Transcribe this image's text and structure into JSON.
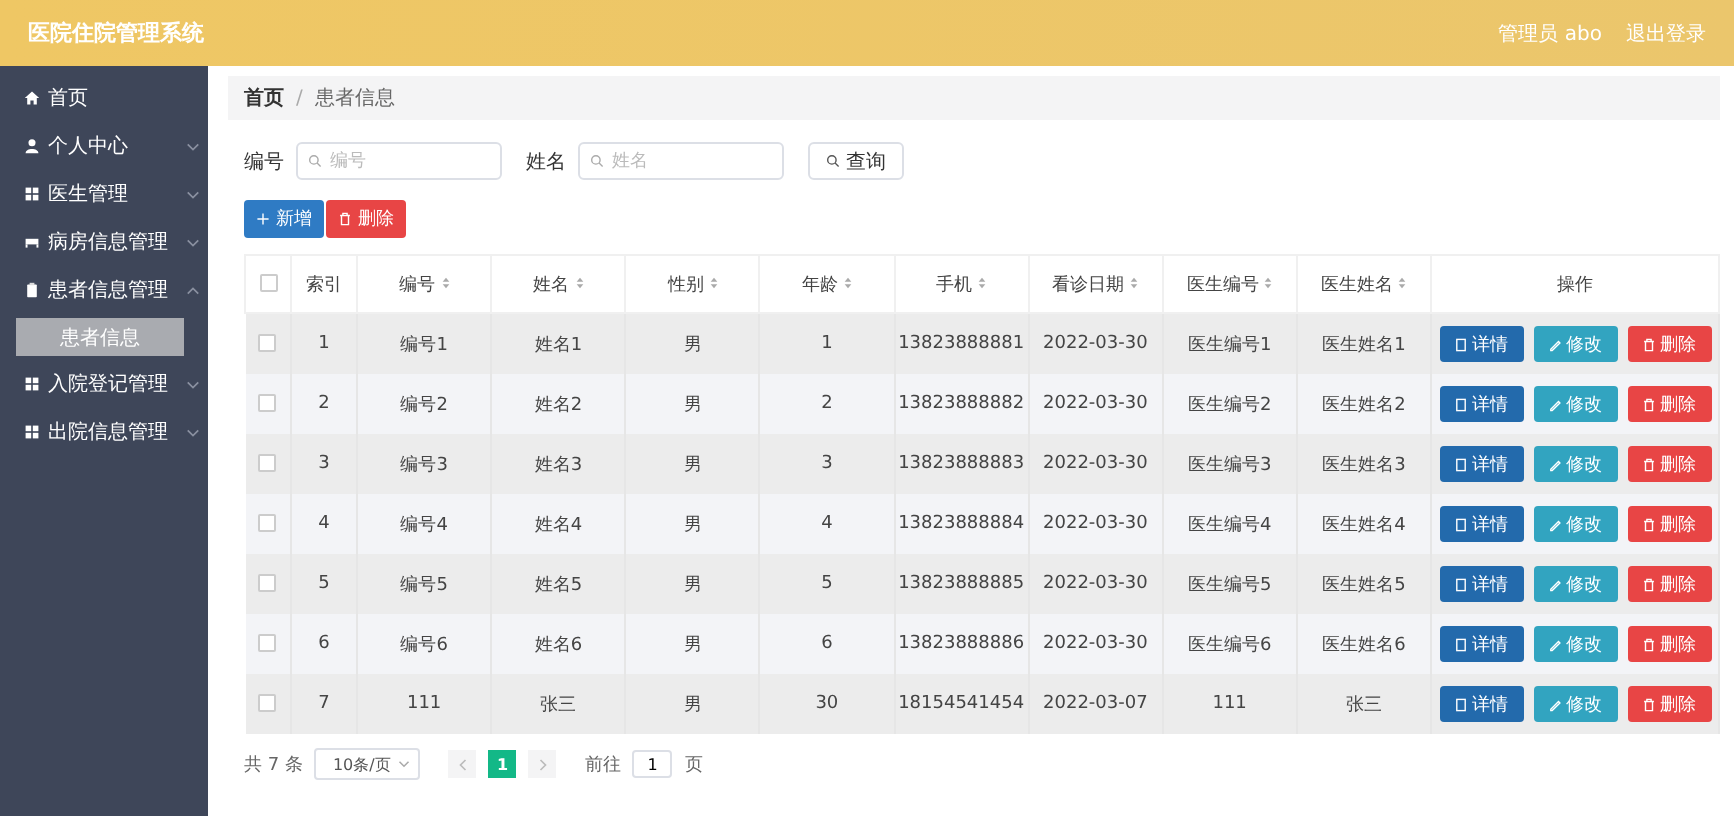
{
  "header": {
    "title": "医院住院管理系统",
    "user": "管理员 abo",
    "logout": "退出登录"
  },
  "sidebar": {
    "items": [
      {
        "label": "首页",
        "kind": "link"
      },
      {
        "label": "个人中心",
        "kind": "submenu",
        "expanded": false
      },
      {
        "label": "医生管理",
        "kind": "submenu",
        "expanded": false
      },
      {
        "label": "病房信息管理",
        "kind": "submenu",
        "expanded": false
      },
      {
        "label": "患者信息管理",
        "kind": "submenu",
        "expanded": true,
        "children": [
          {
            "label": "患者信息",
            "selected": true
          }
        ]
      },
      {
        "label": "入院登记管理",
        "kind": "submenu",
        "expanded": false
      },
      {
        "label": "出院信息管理",
        "kind": "submenu",
        "expanded": false
      }
    ]
  },
  "breadcrumb": {
    "separator": "/",
    "items": [
      "首页",
      "患者信息"
    ]
  },
  "search": {
    "fields": [
      {
        "label": "编号",
        "placeholder": "编号"
      },
      {
        "label": "姓名",
        "placeholder": "姓名"
      }
    ],
    "button": "查询"
  },
  "actions": [
    {
      "label": "新增",
      "kind": "add"
    },
    {
      "label": "删除",
      "kind": "delete"
    }
  ],
  "table": {
    "all_checked": false,
    "columns": [
      {
        "label": "索引",
        "sortable": false
      },
      {
        "label": "编号",
        "sortable": true
      },
      {
        "label": "姓名",
        "sortable": true
      },
      {
        "label": "性别",
        "sortable": true
      },
      {
        "label": "年龄",
        "sortable": true
      },
      {
        "label": "手机",
        "sortable": true
      },
      {
        "label": "看诊日期",
        "sortable": true
      },
      {
        "label": "医生编号",
        "sortable": true
      },
      {
        "label": "医生姓名",
        "sortable": true
      },
      {
        "label": "操作",
        "sortable": false
      }
    ],
    "rows": [
      {
        "checked": false,
        "cells": [
          "1",
          "编号1",
          "姓名1",
          "男",
          "1",
          "13823888881",
          "2022-03-30",
          "医生编号1",
          "医生姓名1"
        ],
        "buttons": [
          {
            "label": "详情",
            "kind": "detail"
          },
          {
            "label": "修改",
            "kind": "edit"
          },
          {
            "label": "删除",
            "kind": "delete"
          }
        ]
      },
      {
        "checked": false,
        "cells": [
          "2",
          "编号2",
          "姓名2",
          "男",
          "2",
          "13823888882",
          "2022-03-30",
          "医生编号2",
          "医生姓名2"
        ],
        "buttons": [
          {
            "label": "详情",
            "kind": "detail"
          },
          {
            "label": "修改",
            "kind": "edit"
          },
          {
            "label": "删除",
            "kind": "delete"
          }
        ]
      },
      {
        "checked": false,
        "cells": [
          "3",
          "编号3",
          "姓名3",
          "男",
          "3",
          "13823888883",
          "2022-03-30",
          "医生编号3",
          "医生姓名3"
        ],
        "buttons": [
          {
            "label": "详情",
            "kind": "detail"
          },
          {
            "label": "修改",
            "kind": "edit"
          },
          {
            "label": "删除",
            "kind": "delete"
          }
        ]
      },
      {
        "checked": false,
        "cells": [
          "4",
          "编号4",
          "姓名4",
          "男",
          "4",
          "13823888884",
          "2022-03-30",
          "医生编号4",
          "医生姓名4"
        ],
        "buttons": [
          {
            "label": "详情",
            "kind": "detail"
          },
          {
            "label": "修改",
            "kind": "edit"
          },
          {
            "label": "删除",
            "kind": "delete"
          }
        ]
      },
      {
        "checked": false,
        "cells": [
          "5",
          "编号5",
          "姓名5",
          "男",
          "5",
          "13823888885",
          "2022-03-30",
          "医生编号5",
          "医生姓名5"
        ],
        "buttons": [
          {
            "label": "详情",
            "kind": "detail"
          },
          {
            "label": "修改",
            "kind": "edit"
          },
          {
            "label": "删除",
            "kind": "delete"
          }
        ]
      },
      {
        "checked": false,
        "cells": [
          "6",
          "编号6",
          "姓名6",
          "男",
          "6",
          "13823888886",
          "2022-03-30",
          "医生编号6",
          "医生姓名6"
        ],
        "buttons": [
          {
            "label": "详情",
            "kind": "detail"
          },
          {
            "label": "修改",
            "kind": "edit"
          },
          {
            "label": "删除",
            "kind": "delete"
          }
        ]
      },
      {
        "checked": false,
        "cells": [
          "7",
          "111",
          "张三",
          "男",
          "30",
          "18154541454",
          "2022-03-07",
          "111",
          "张三"
        ],
        "buttons": [
          {
            "label": "详情",
            "kind": "detail"
          },
          {
            "label": "修改",
            "kind": "edit"
          },
          {
            "label": "删除",
            "kind": "delete"
          }
        ]
      }
    ]
  },
  "pagination": {
    "total": "共 7 条",
    "page_size": "10条/页",
    "pages": [
      {
        "label": "1",
        "selected": true
      }
    ],
    "goto_label": "前往",
    "goto_value": "1",
    "goto_suffix": "页"
  }
}
